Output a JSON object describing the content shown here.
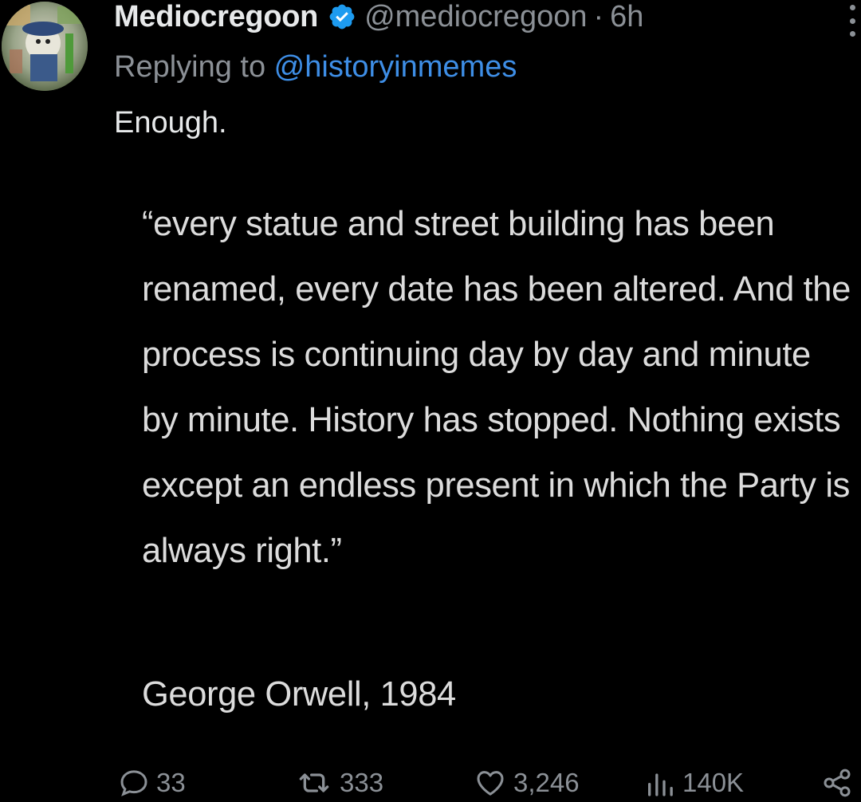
{
  "tweet": {
    "author": {
      "display_name": "Mediocregoon",
      "handle": "@mediocregoon",
      "separator": "·",
      "time": "6h",
      "avatar_icon": "avatar-image",
      "verified_icon": "verified-badge-icon"
    },
    "reply": {
      "prefix": "Replying to ",
      "mention": "@historyinmemes"
    },
    "text": "Enough.",
    "quote_image": {
      "text": "“every statue and street building has been renamed, every date has been altered. And the process is continuing day by day and minute by minute. History has stopped. Nothing exists except an endless present in which the Party is always right.”",
      "attribution": "George Orwell, 1984"
    },
    "actions": {
      "replies": "33",
      "retweets": "333",
      "likes": "3,246",
      "views": "140K"
    },
    "menu_icon": "more-vertical-icon"
  },
  "colors": {
    "background": "#000000",
    "text_primary": "#e7e9ea",
    "text_secondary": "#8b9096",
    "link": "#3e8ee6",
    "verified": "#1d9bf0"
  }
}
